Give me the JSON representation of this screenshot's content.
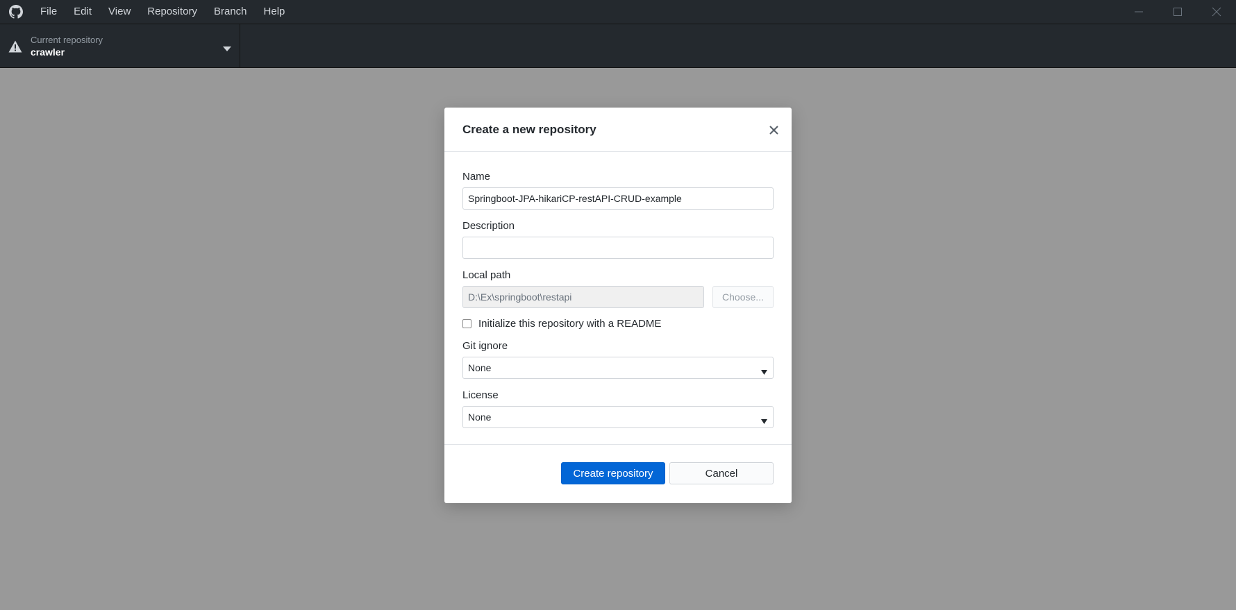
{
  "menu": {
    "items": [
      "File",
      "Edit",
      "View",
      "Repository",
      "Branch",
      "Help"
    ]
  },
  "toolbar": {
    "current_repo_caption": "Current repository",
    "current_repo_name": "crawler"
  },
  "dialog": {
    "title": "Create a new repository",
    "name_label": "Name",
    "name_value": "Springboot-JPA-hikariCP-restAPI-CRUD-example",
    "description_label": "Description",
    "description_value": "",
    "local_path_label": "Local path",
    "local_path_value": "D:\\Ex\\springboot\\restapi",
    "choose_label": "Choose...",
    "readme_label": "Initialize this repository with a README",
    "readme_checked": false,
    "gitignore_label": "Git ignore",
    "gitignore_value": "None",
    "license_label": "License",
    "license_value": "None",
    "create_label": "Create repository",
    "cancel_label": "Cancel"
  },
  "colors": {
    "titlebar": "#24292e",
    "overlay": "#999999",
    "primary": "#0366d6"
  },
  "icons": [
    "github-logo-icon",
    "minimize-icon",
    "maximize-icon",
    "close-window-icon",
    "warning-icon",
    "caret-down-icon",
    "close-icon"
  ]
}
